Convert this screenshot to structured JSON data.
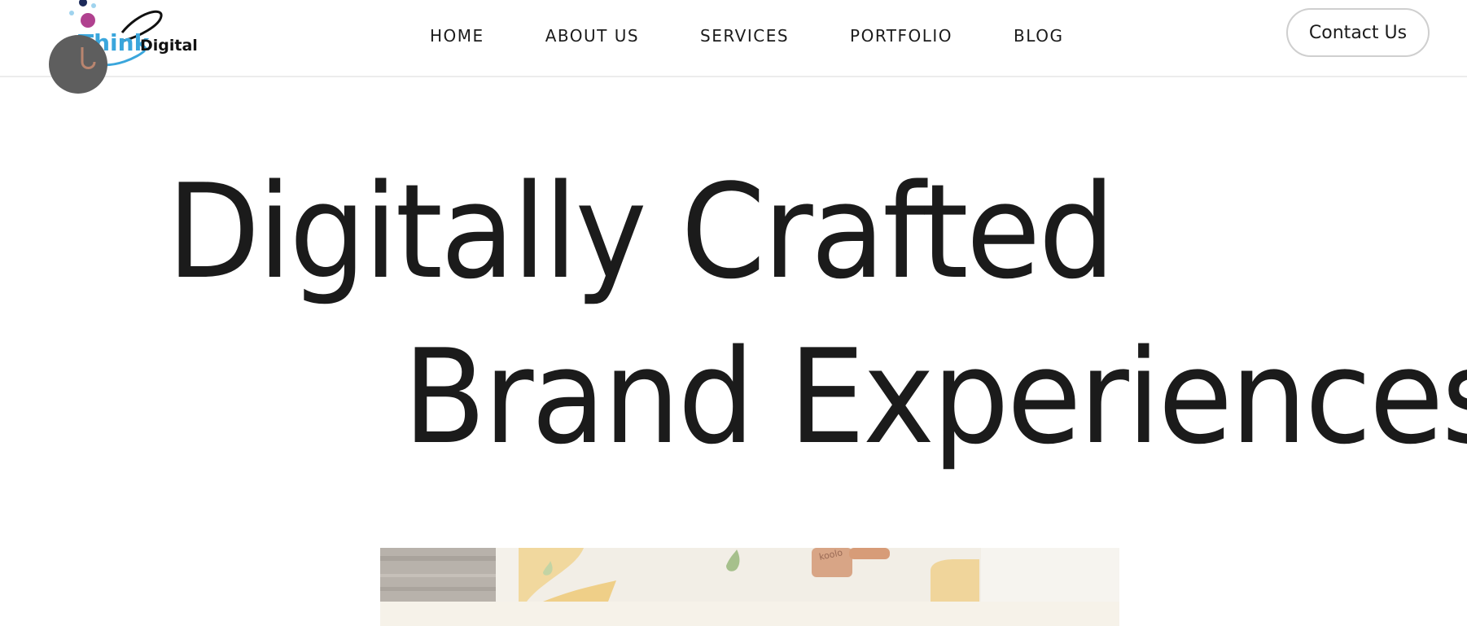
{
  "brand": {
    "logo_text_think": "Think",
    "logo_text_digital": "Digital",
    "colors": {
      "blue": "#3aa6dc",
      "magenta": "#b0418f",
      "navy": "#1c2a5a",
      "dark": "#111111"
    }
  },
  "nav": {
    "items": [
      {
        "label": "HOME"
      },
      {
        "label": "ABOUT US"
      },
      {
        "label": "SERVICES"
      },
      {
        "label": "PORTFOLIO"
      },
      {
        "label": "BLOG"
      }
    ]
  },
  "header": {
    "contact_label": "Contact Us"
  },
  "hero": {
    "line1": "Digitally Crafted",
    "line2": "Brand Experiences"
  },
  "preview": {
    "product_text": "koolo"
  }
}
